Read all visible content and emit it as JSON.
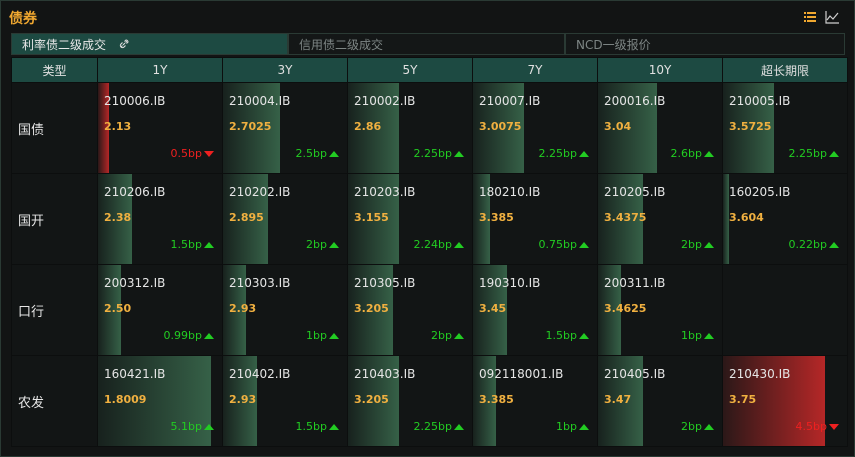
{
  "panel": {
    "title": "债券",
    "list_icon": "list-icon",
    "chart_icon": "line-chart-icon"
  },
  "tabs": [
    {
      "label": "利率债二级成交",
      "active": true,
      "icon": "link-icon"
    },
    {
      "label": "信用债二级成交",
      "active": false
    },
    {
      "label": "NCD一级报价",
      "active": false
    }
  ],
  "table": {
    "headers": [
      "类型",
      "1Y",
      "3Y",
      "5Y",
      "7Y",
      "10Y",
      "超长期限"
    ],
    "rows": [
      {
        "type": "国债",
        "cells": [
          {
            "code": "210006.IB",
            "yield": "2.13",
            "change": "0.5bp",
            "dir": "down",
            "level": 0.1
          },
          {
            "code": "210004.IB",
            "yield": "2.7025",
            "change": "2.5bp",
            "dir": "up",
            "level": 0.5
          },
          {
            "code": "210002.IB",
            "yield": "2.86",
            "change": "2.25bp",
            "dir": "up",
            "level": 0.45
          },
          {
            "code": "210007.IB",
            "yield": "3.0075",
            "change": "2.25bp",
            "dir": "up",
            "level": 0.45
          },
          {
            "code": "200016.IB",
            "yield": "3.04",
            "change": "2.6bp",
            "dir": "up",
            "level": 0.52
          },
          {
            "code": "210005.IB",
            "yield": "3.5725",
            "change": "2.25bp",
            "dir": "up",
            "level": 0.45
          }
        ]
      },
      {
        "type": "国开",
        "cells": [
          {
            "code": "210206.IB",
            "yield": "2.38",
            "change": "1.5bp",
            "dir": "up",
            "level": 0.3
          },
          {
            "code": "210202.IB",
            "yield": "2.895",
            "change": "2bp",
            "dir": "up",
            "level": 0.4
          },
          {
            "code": "210203.IB",
            "yield": "3.155",
            "change": "2.24bp",
            "dir": "up",
            "level": 0.45
          },
          {
            "code": "180210.IB",
            "yield": "3.385",
            "change": "0.75bp",
            "dir": "up",
            "level": 0.15
          },
          {
            "code": "210205.IB",
            "yield": "3.4375",
            "change": "2bp",
            "dir": "up",
            "level": 0.4
          },
          {
            "code": "160205.IB",
            "yield": "3.604",
            "change": "0.22bp",
            "dir": "up",
            "level": 0.05
          }
        ]
      },
      {
        "type": "口行",
        "cells": [
          {
            "code": "200312.IB",
            "yield": "2.50",
            "change": "0.99bp",
            "dir": "up",
            "level": 0.2
          },
          {
            "code": "210303.IB",
            "yield": "2.93",
            "change": "1bp",
            "dir": "up",
            "level": 0.2
          },
          {
            "code": "210305.IB",
            "yield": "3.205",
            "change": "2bp",
            "dir": "up",
            "level": 0.4
          },
          {
            "code": "190310.IB",
            "yield": "3.45",
            "change": "1.5bp",
            "dir": "up",
            "level": 0.3
          },
          {
            "code": "200311.IB",
            "yield": "3.4625",
            "change": "1bp",
            "dir": "up",
            "level": 0.2
          },
          null
        ]
      },
      {
        "type": "农发",
        "cells": [
          {
            "code": "160421.IB",
            "yield": "1.8009",
            "change": "5.1bp",
            "dir": "up",
            "level": 1.0
          },
          {
            "code": "210402.IB",
            "yield": "2.93",
            "change": "1.5bp",
            "dir": "up",
            "level": 0.3
          },
          {
            "code": "210403.IB",
            "yield": "3.205",
            "change": "2.25bp",
            "dir": "up",
            "level": 0.45
          },
          {
            "code": "092118001.IB",
            "yield": "3.385",
            "change": "1bp",
            "dir": "up",
            "level": 0.2
          },
          {
            "code": "210405.IB",
            "yield": "3.47",
            "change": "2bp",
            "dir": "up",
            "level": 0.4
          },
          {
            "code": "210430.IB",
            "yield": "3.75",
            "change": "4.5bp",
            "dir": "down",
            "level": 0.9
          }
        ]
      }
    ]
  },
  "colors": {
    "up": "#22cc22",
    "down": "#ee2020",
    "yield": "#f0b040",
    "title": "#f0a830",
    "header_bg": "#1d4a42"
  }
}
